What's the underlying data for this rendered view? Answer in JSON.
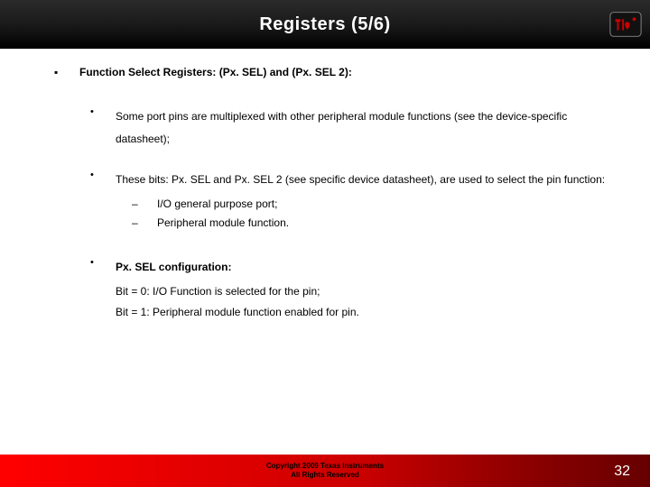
{
  "header": {
    "title": "Registers (5/6)"
  },
  "body": {
    "heading": "Function Select Registers: (Px. SEL) and (Px. SEL 2):",
    "items": [
      "Some port pins are multiplexed with other peripheral module functions (see the device-specific datasheet);",
      "These bits: Px. SEL and Px. SEL 2 (see specific device datasheet), are used to select the pin function:"
    ],
    "sub": [
      "I/O general purpose port;",
      "Peripheral module function."
    ],
    "config_heading": "Px. SEL configuration:",
    "config": [
      "Bit = 0: I/O Function is selected for the pin;",
      "Bit = 1: Peripheral module function enabled for pin."
    ]
  },
  "footer": {
    "line1": "Copyright  2009 Texas Instruments",
    "line2": "All Rights Reserved",
    "page": "32"
  }
}
